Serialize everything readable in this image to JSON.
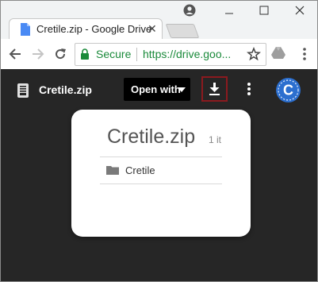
{
  "browser": {
    "tab": {
      "title": "Cretile.zip - Google Drive",
      "close_glyph": "✕"
    },
    "window_controls": [
      "minimize",
      "maximize",
      "close"
    ],
    "omnibox": {
      "secure_label": "Secure",
      "url": "https://drive.goo..."
    }
  },
  "viewer": {
    "file_name": "Cretile.zip",
    "open_with_label": "Open with",
    "avatar_letter": "C"
  },
  "card": {
    "title": "Cretile.zip",
    "count_text": "1 it",
    "items": [
      {
        "name": "Cretile",
        "type": "folder"
      }
    ]
  },
  "colors": {
    "viewer_bg": "#262626",
    "download_highlight": "#8b1a1f",
    "secure_green": "#1a8a3a",
    "avatar_blue": "#2c6fcf"
  }
}
